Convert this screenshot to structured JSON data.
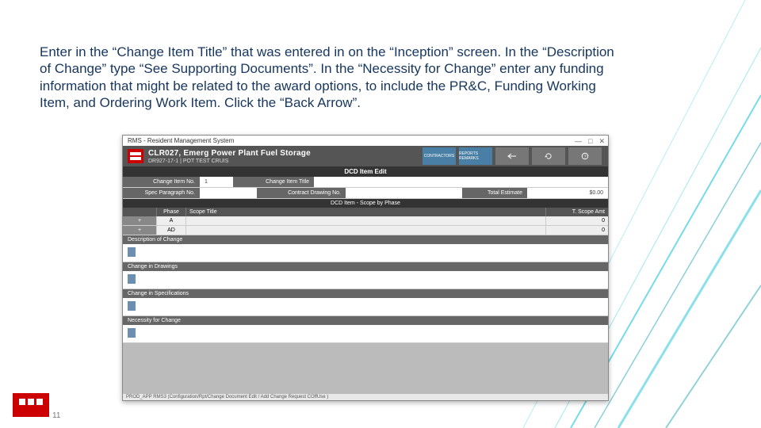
{
  "instructions": "Enter in the “Change Item Title” that was entered in on the “Inception” screen. In the “Description of Change” type “See Supporting Documents”. In the “Necessity for Change” enter any funding information that might be related to the award options, to include the PR&C, Funding Working Item, and Ordering Work Item. Click the “Back Arrow”.",
  "window": {
    "title": "RMS - Resident Management System",
    "min": "—",
    "max": "□",
    "close": "✕"
  },
  "header": {
    "project_title": "CLR027, Emerg Power Plant Fuel Storage",
    "project_sub": "DR927-17-1 | POT TEST CRUIS",
    "buttons": {
      "contractors": "CONTRACTORS",
      "reports": "REPORTS  REMARKS",
      "back": "",
      "refresh": "",
      "help": ""
    }
  },
  "tab_label": "DCD Item Edit",
  "form": {
    "row1_label": "Change Item No.",
    "row1_value": "1",
    "row1_label2": "Change Item Title",
    "row1_value2": "",
    "row2_label": "Spec Paragraph No.",
    "row2_value": "",
    "row2_label2": "Contract Drawing No.",
    "row2_value2": "",
    "row2_label3": "Total Estimate",
    "row2_value3": "$0.00"
  },
  "scope_label": "DCD Item - Scope by Phase",
  "grid": {
    "h1": "",
    "h2": "Phase",
    "h3": "Scope Title",
    "h4": "T. Scope Amt",
    "rows": [
      {
        "btn": "+",
        "phase": "A",
        "title": "",
        "amt": "0"
      },
      {
        "btn": "+",
        "phase": "AD",
        "title": "",
        "amt": "0"
      }
    ]
  },
  "sections": {
    "s1": "Description of Change",
    "s2": "Change in Drawings",
    "s3": "Change in Specifications",
    "s4": "Necessity for Change"
  },
  "status_bar": "PROD_APP RMS3 (Configuration/Rpt/Change Document Edit / Add Change Request COffUse )",
  "page_number": "11"
}
